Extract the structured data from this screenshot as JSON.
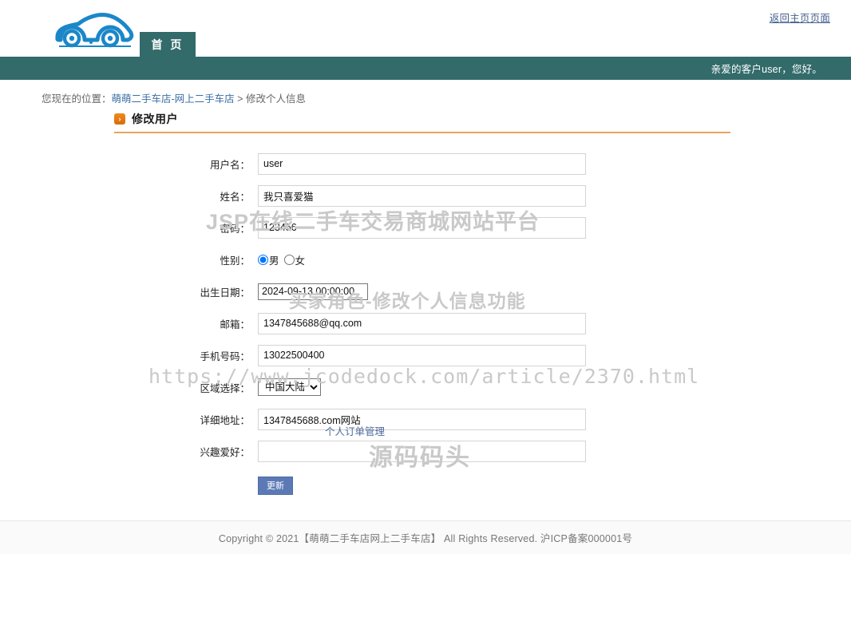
{
  "header": {
    "logo_name": "car-logo",
    "home_link": "返回主页页面",
    "nav_tab": "首 页"
  },
  "greeting": {
    "text": "亲爱的客户user，您好。"
  },
  "breadcrumb": {
    "prefix": "您现在的位置：",
    "link": "萌萌二手车店-网上二手车店",
    "separator": " > ",
    "current": "修改个人信息"
  },
  "panel": {
    "bullet": "›",
    "title": "修改用户"
  },
  "form": {
    "fields": [
      {
        "label": "用户名：",
        "value": "user",
        "type": "text"
      },
      {
        "label": "姓名：",
        "value": "我只喜爱猫",
        "type": "text"
      },
      {
        "label": "密码：",
        "value": "123456",
        "type": "text"
      },
      {
        "label": "性别：",
        "type": "radio"
      },
      {
        "label": "出生日期：",
        "value": "2024-09-13 00:00:00",
        "type": "date"
      },
      {
        "label": "邮箱：",
        "value": "1347845688@qq.com",
        "type": "text"
      },
      {
        "label": "手机号码：",
        "value": "13022500400",
        "type": "text"
      },
      {
        "label": "区域选择：",
        "value": "中国大陆",
        "type": "select"
      },
      {
        "label": "详细地址：",
        "value": "1347845688.com网站",
        "type": "text"
      },
      {
        "label": "兴趣爱好：",
        "value": "",
        "type": "text"
      }
    ],
    "gender": {
      "male_label": "男",
      "female_label": "女",
      "selected": "男"
    },
    "region_options": [
      "中国大陆"
    ],
    "submit_label": "更新",
    "order_link": "个人订单管理"
  },
  "footer": {
    "text": "Copyright © 2021【萌萌二手车店网上二手车店】 All Rights Reserved. 沪ICP备案000001号"
  },
  "watermarks": {
    "one": "JSP在线二手车交易商城网站平台",
    "two": "买家角色-修改个人信息功能",
    "three": "https://www.jcodedock.com/article/2370.html",
    "four": "源码码头"
  },
  "colors": {
    "teal": "#336b6b",
    "orange": "#e8a55c",
    "logo_blue": "#1b87c9",
    "button_blue": "#5b7ab5",
    "link_blue": "#3a6ea5"
  }
}
